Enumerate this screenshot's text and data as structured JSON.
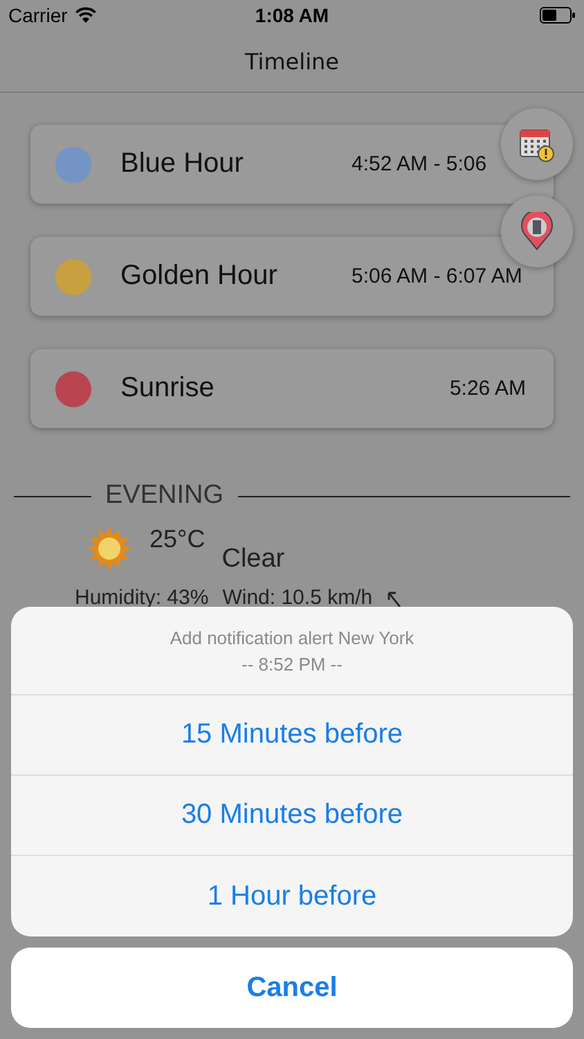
{
  "status_bar": {
    "carrier": "Carrier",
    "time": "1:08 AM"
  },
  "nav_bar": {
    "title": "Timeline"
  },
  "events": [
    {
      "name": "Blue Hour",
      "time": "4:52 AM - 5:06",
      "color": "#7394c4"
    },
    {
      "name": "Golden Hour",
      "time": "5:06 AM - 6:07 AM",
      "color": "#c8a040"
    },
    {
      "name": "Sunrise",
      "time": "5:26 AM",
      "color": "#b84550"
    }
  ],
  "section": {
    "title": "EVENING"
  },
  "weather": {
    "temperature": "25°C",
    "condition": "Clear",
    "humidity": "Humidity: 43%",
    "wind": "Wind: 10.5 km/h"
  },
  "action_sheet": {
    "title": "Add notification alert New York",
    "subtitle": "-- 8:52 PM --",
    "options": [
      "15 Minutes before",
      "30 Minutes before",
      "1 Hour before"
    ],
    "cancel": "Cancel"
  }
}
